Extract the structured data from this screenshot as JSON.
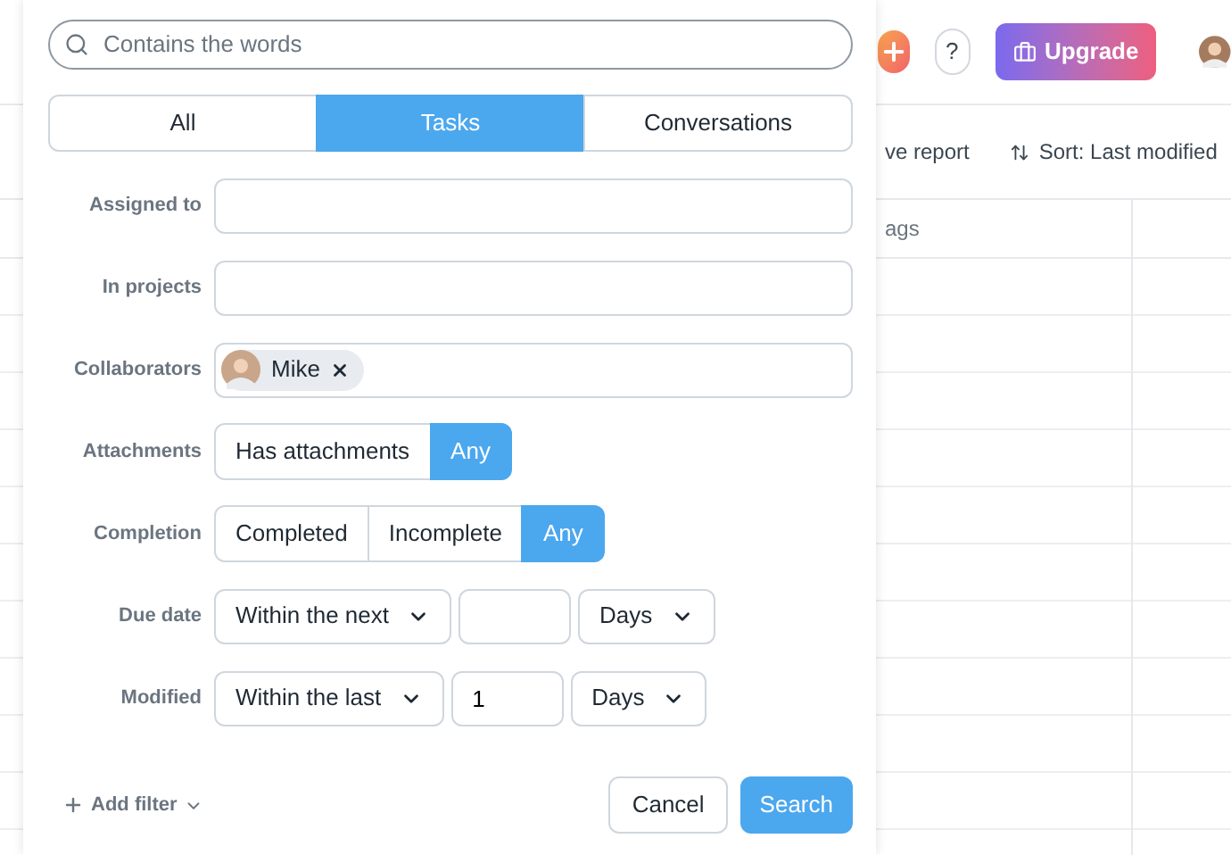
{
  "app": {
    "help": "?",
    "upgrade": "Upgrade",
    "toolbar": [
      "ve report",
      "Sort: Last modified"
    ],
    "column_1": "ags"
  },
  "search": {
    "placeholder": "Contains the words"
  },
  "tabs": [
    {
      "label": "All",
      "selected": false
    },
    {
      "label": "Tasks",
      "selected": true
    },
    {
      "label": "Conversations",
      "selected": false
    }
  ],
  "fields": [
    {
      "kind": "text",
      "label": "Assigned to"
    },
    {
      "kind": "text",
      "label": "In projects"
    },
    {
      "kind": "chips",
      "label": "Collaborators",
      "chips": [
        "Mike"
      ]
    },
    {
      "kind": "segmented",
      "label": "Attachments",
      "options": [
        {
          "label": "Has attachments",
          "selected": false
        },
        {
          "label": "Any",
          "selected": true
        }
      ]
    },
    {
      "kind": "segmented",
      "label": "Completion",
      "options": [
        {
          "label": "Completed",
          "selected": false
        },
        {
          "label": "Incomplete",
          "selected": false
        },
        {
          "label": "Any",
          "selected": true
        }
      ]
    },
    {
      "kind": "range",
      "label": "Due date",
      "mode": "Within the next",
      "unit": "Days"
    },
    {
      "kind": "range",
      "label": "Modified",
      "mode": "Within the last",
      "amount": "1",
      "unit": "Days"
    }
  ],
  "footer": {
    "add_filter": "Add filter",
    "cancel": "Cancel",
    "search": "Search"
  }
}
